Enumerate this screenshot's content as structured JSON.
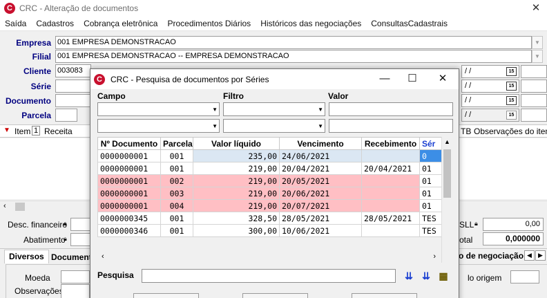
{
  "window": {
    "title": "CRC - Alteração de documentos",
    "close": "✕"
  },
  "menu": [
    "Saída",
    "Cadastros",
    "Cobrança eletrônica",
    "Procedimentos Diários",
    "Históricos das negociações",
    "ConsultasCadastrais"
  ],
  "form": {
    "empresa_label": "Empresa",
    "empresa_value": "001 EMPRESA DEMONSTRACAO",
    "filial_label": "Filial",
    "filial_value": "001 EMPRESA DEMONSTRACAO -- EMPRESA DEMONSTRACAO",
    "cliente_label": "Cliente",
    "cliente_value": "003083",
    "serie_label": "Série",
    "documento_label": "Documento",
    "parcela_label": "Parcela",
    "date_placeholder": "/  /"
  },
  "background": {
    "item_label": "Item",
    "item_num": "1",
    "receita_label": "Receita",
    "tb_label": "TB",
    "obs_item_label": "Observações do item",
    "desc_financeiro": "Desc. financeiro",
    "abatimento": "Abatimento",
    "sll_label": "SLL",
    "sll_value": "0,00",
    "total_label": "otal",
    "total_value": "0,000000",
    "tab_diversos": "Diversos",
    "tab_document": "Document",
    "tab_negociacao": "o de negociação",
    "moeda": "Moeda",
    "observacoes": "Observações",
    "lo_origem": "lo origem"
  },
  "dialog": {
    "title": "CRC - Pesquisa de documentos por Séries",
    "campo_label": "Campo",
    "filtro_label": "Filtro",
    "valor_label": "Valor",
    "pesquisa_label": "Pesquisa",
    "columns": [
      "Nº Documento",
      "Parcela",
      "Valor líquido",
      "Vencimento",
      "Recebimento",
      "Sér"
    ],
    "rows": [
      {
        "doc": "0000000001",
        "parcela": "001",
        "valor": "235,00",
        "venc": "24/06/2021",
        "rec": "",
        "serie": "0",
        "style": "sel"
      },
      {
        "doc": "0000000001",
        "parcela": "001",
        "valor": "219,00",
        "venc": "20/04/2021",
        "rec": "20/04/2021",
        "serie": "01",
        "style": ""
      },
      {
        "doc": "0000000001",
        "parcela": "002",
        "valor": "219,00",
        "venc": "20/05/2021",
        "rec": "",
        "serie": "01",
        "style": "pink"
      },
      {
        "doc": "0000000001",
        "parcela": "003",
        "valor": "219,00",
        "venc": "20/06/2021",
        "rec": "",
        "serie": "01",
        "style": "pink"
      },
      {
        "doc": "0000000001",
        "parcela": "004",
        "valor": "219,00",
        "venc": "20/07/2021",
        "rec": "",
        "serie": "01",
        "style": "pink"
      },
      {
        "doc": "0000000345",
        "parcela": "001",
        "valor": "328,50",
        "venc": "28/05/2021",
        "rec": "28/05/2021",
        "serie": "TES",
        "style": ""
      },
      {
        "doc": "0000000346",
        "parcela": "001",
        "valor": "300,00",
        "venc": "10/06/2021",
        "rec": "",
        "serie": "TES",
        "style": ""
      }
    ]
  },
  "colors": {
    "label_blue": "#000080",
    "pink_row": "#ffbfc4",
    "selected_cell": "#3c8ee6",
    "logo_red": "#c8102e"
  }
}
